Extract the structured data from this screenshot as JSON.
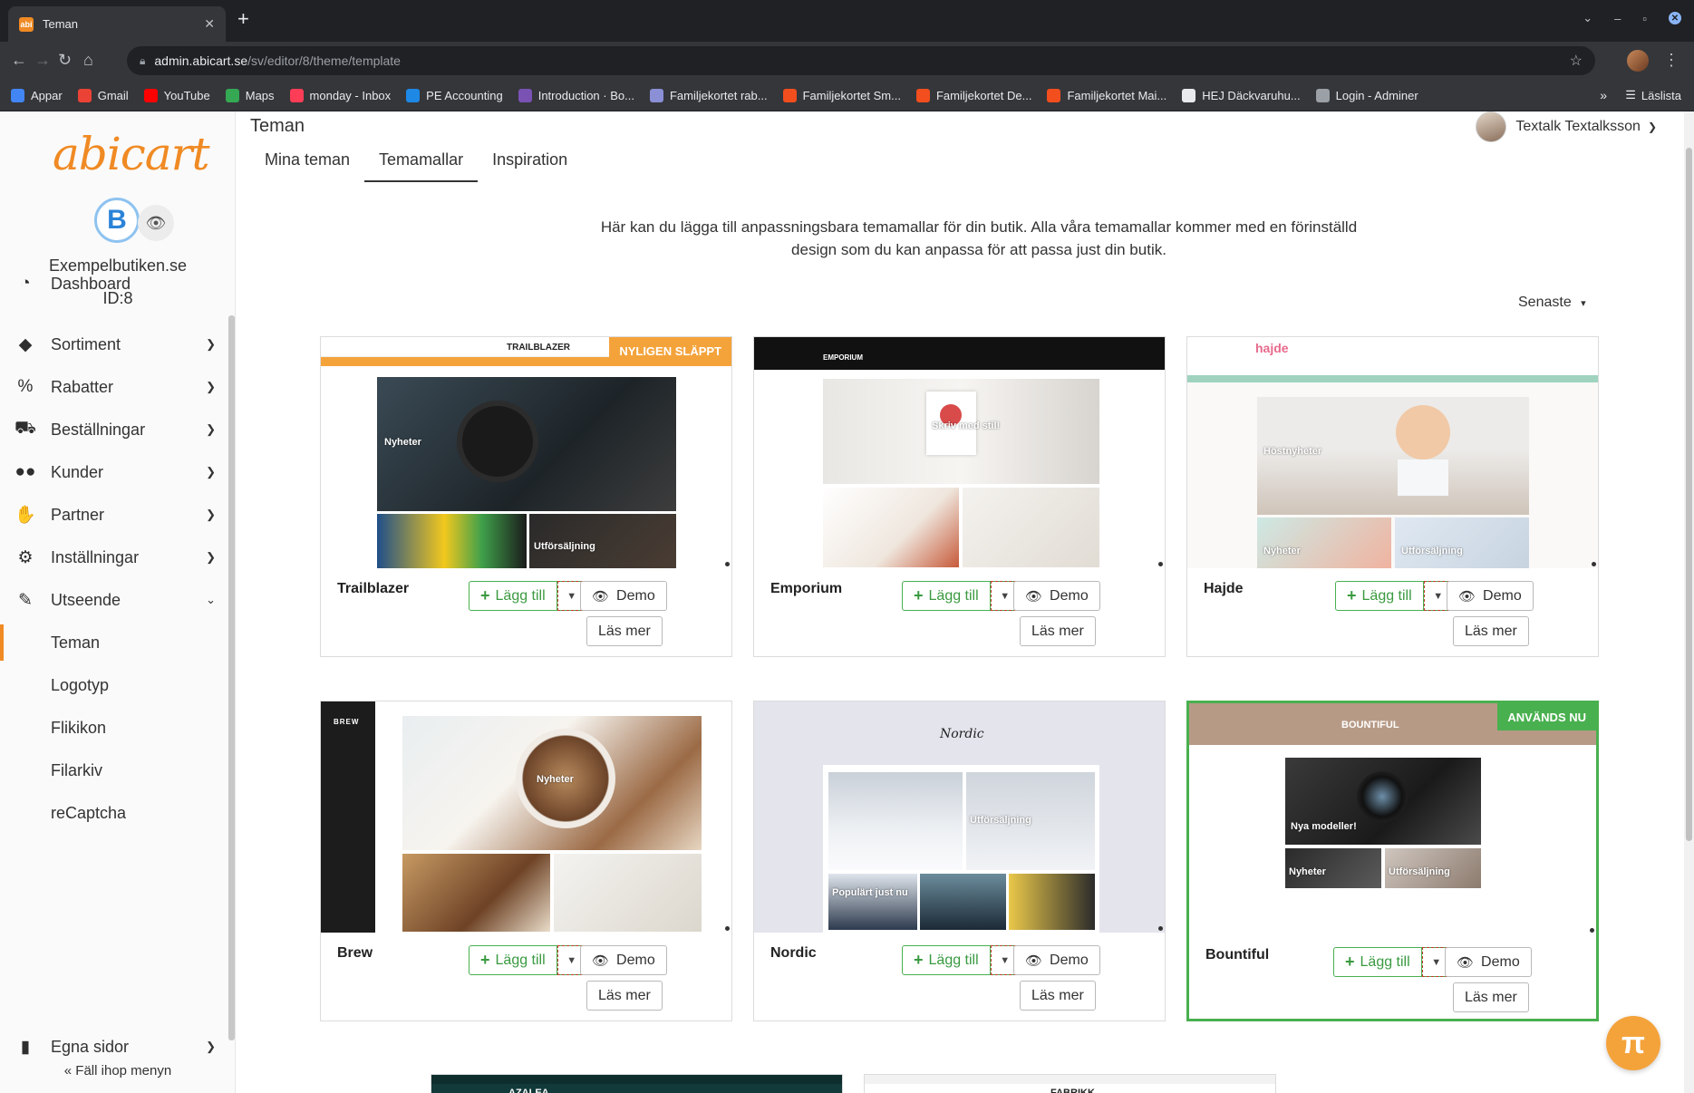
{
  "browser": {
    "tab_title": "Teman",
    "favicon": "abicart-favicon",
    "url_host": "admin.abicart.se",
    "url_path": "/sv/editor/8/theme/template",
    "bookmarks": [
      {
        "label": "Appar",
        "color": "#4285f4",
        "icon": "apps-grid-icon"
      },
      {
        "label": "Gmail",
        "color": "#ea4335",
        "icon": "gmail-icon"
      },
      {
        "label": "YouTube",
        "color": "#ff0000",
        "icon": "youtube-icon"
      },
      {
        "label": "Maps",
        "color": "#34a853",
        "icon": "maps-pin-icon"
      },
      {
        "label": "monday - Inbox",
        "color": "#ff3d57",
        "icon": "monday-icon"
      },
      {
        "label": "PE Accounting",
        "color": "#1e88e5",
        "icon": "pe-icon"
      },
      {
        "label": "Introduction · Bo...",
        "color": "#7952b3",
        "icon": "bootstrap-icon"
      },
      {
        "label": "Familjekortet rab...",
        "color": "#8a8fd6",
        "icon": "globe-icon"
      },
      {
        "label": "Familjekortet Sm...",
        "color": "#f24e1e",
        "icon": "figma-icon"
      },
      {
        "label": "Familjekortet De...",
        "color": "#f24e1e",
        "icon": "figma-icon"
      },
      {
        "label": "Familjekortet Mai...",
        "color": "#f24e1e",
        "icon": "figma-icon"
      },
      {
        "label": "HEJ Däckvaruhu...",
        "color": "#e8eaed",
        "icon": "globe-icon"
      },
      {
        "label": "Login - Adminer",
        "color": "#9aa0a6",
        "icon": "adminer-icon"
      }
    ],
    "bookmarks_more": "»",
    "reading_list": "Läslista"
  },
  "sidebar": {
    "logo": "abicart",
    "store_name": "Exempelbutiken.se",
    "store_id": "ID:8",
    "nav": [
      {
        "label": "Dashboard",
        "icon": "gauge-icon",
        "has_chevron": false
      },
      {
        "label": "Sortiment",
        "icon": "tag-icon",
        "has_chevron": true
      },
      {
        "label": "Rabatter",
        "icon": "percent-icon",
        "has_chevron": true
      },
      {
        "label": "Beställningar",
        "icon": "cart-icon",
        "has_chevron": true
      },
      {
        "label": "Kunder",
        "icon": "users-icon",
        "has_chevron": true
      },
      {
        "label": "Partner",
        "icon": "handshake-icon",
        "has_chevron": true
      },
      {
        "label": "Inställningar",
        "icon": "gear-icon",
        "has_chevron": true
      },
      {
        "label": "Utseende",
        "icon": "brush-icon",
        "has_chevron": true,
        "expanded": true
      }
    ],
    "sub": [
      "Teman",
      "Logotyp",
      "Flikikon",
      "Filarkiv",
      "reCaptcha"
    ],
    "active_sub": "Teman",
    "pages": {
      "label": "Egna sidor",
      "icon": "file-icon"
    },
    "collapse_label": "« Fäll ihop menyn"
  },
  "header": {
    "title": "Teman",
    "tabs": [
      "Mina teman",
      "Temamallar",
      "Inspiration"
    ],
    "active_tab": "Temamallar",
    "user_name": "Textalk Textalksson"
  },
  "intro_text": "Här kan du lägga till anpassningsbara temamallar för din butik. Alla våra temamallar kommer med en förinställd design som du kan anpassa för att passa just din butik.",
  "sort_label": "Senaste",
  "buttons": {
    "add": "Lägg till",
    "demo": "Demo",
    "more": "Läs mer"
  },
  "themes": [
    {
      "name": "Trailblazer",
      "badge": "NYLIGEN SLÄPPT",
      "preview_brand": "TRAILBLAZER",
      "preview_labels": [
        "Nyheter",
        "Utförsäljning"
      ]
    },
    {
      "name": "Emporium",
      "badge": "",
      "preview_brand": "EMPORIUM",
      "preview_labels": [
        "Skriv med stil!"
      ]
    },
    {
      "name": "Hajde",
      "badge": "",
      "preview_brand": "hajde",
      "preview_labels": [
        "Höstnyheter",
        "Nyheter",
        "Utförsäljning"
      ]
    },
    {
      "name": "Brew",
      "badge": "",
      "preview_brand": "BREW",
      "preview_labels": [
        "Nyheter"
      ]
    },
    {
      "name": "Nordic",
      "badge": "",
      "preview_brand": "Nordic",
      "preview_labels": [
        "Populärt just nu",
        "Utförsäljning"
      ]
    },
    {
      "name": "Bountiful",
      "badge": "ANVÄNDS NU",
      "preview_brand": "BOUNTIFUL",
      "preview_labels": [
        "Nya modeller!",
        "Nyheter",
        "Utförsäljning"
      ]
    }
  ],
  "next_row": [
    {
      "preview_brand": "AZALEA"
    },
    {
      "preview_brand": "FABRIKK"
    }
  ],
  "fab_icon": "pi-icon",
  "fab_label": "π",
  "colors": {
    "brand": "#f08a24",
    "success": "#49b04f",
    "badge_new": "#f4a33b"
  }
}
